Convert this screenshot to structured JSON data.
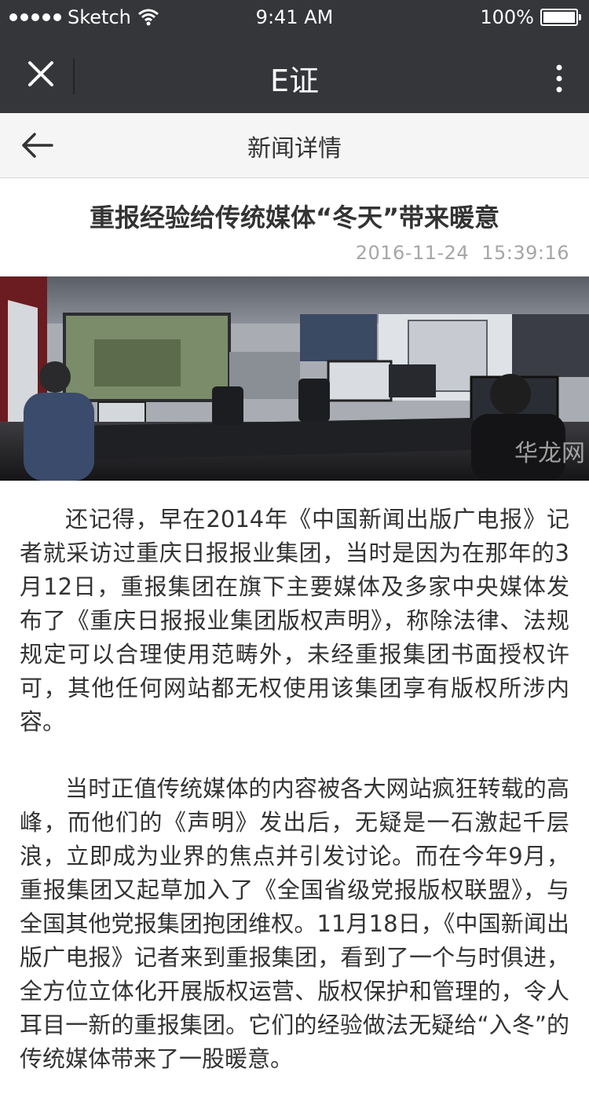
{
  "status_bar": {
    "carrier": "Sketch",
    "time": "9:41 AM",
    "battery": "100%"
  },
  "wechat_header": {
    "title": "E证",
    "close_icon": "close-icon",
    "more_icon": "more-vertical-icon"
  },
  "nav": {
    "title": "新闻详情",
    "back_icon": "arrow-left-icon"
  },
  "article": {
    "title": "重报经验给传统媒体“冬天”带来暖意",
    "date": "2016-11-24",
    "time": "15:39:16",
    "image_watermark": "华龙网",
    "paragraphs": [
      "还记得，早在2014年《中国新闻出版广电报》记者就采访过重庆日报报业集团，当时是因为在那年的3月12日，重报集团在旗下主要媒体及多家中央媒体发布了《重庆日报报业集团版权声明》，称除法律、法规规定可以合理使用范畴外，未经重报集团书面授权许可，其他任何网站都无权使用该集团享有版权所涉内容。",
      "当时正值传统媒体的内容被各大网站疯狂转载的高峰，而他们的《声明》发出后，无疑是一石激起千层浪，立即成为业界的焦点并引发讨论。而在今年9月，重报集团又起草加入了《全国省级党报版权联盟》，与全国其他党报集团抱团维权。11月18日，《中国新闻出版广电报》记者来到重报集团，看到了一个与时俱进，全方位立体化开展版权运营、版权保护和管理的，令人耳目一新的重报集团。它们的经验做法无疑给“入冬”的传统媒体带来了一股暖意。"
    ]
  }
}
